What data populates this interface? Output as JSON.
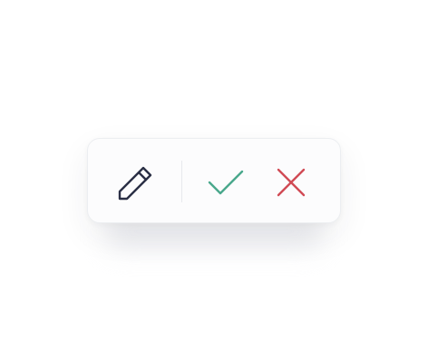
{
  "toolbar": {
    "actions": [
      {
        "id": "edit",
        "icon": "pencil-icon",
        "color": "#2a2f45"
      },
      {
        "id": "confirm",
        "icon": "check-icon",
        "color": "#4aa88c"
      },
      {
        "id": "cancel",
        "icon": "x-icon",
        "color": "#d14b55"
      }
    ],
    "colors": {
      "background": "#fcfcfd",
      "border": "#eceef1",
      "divider": "#e7e9ed"
    }
  }
}
